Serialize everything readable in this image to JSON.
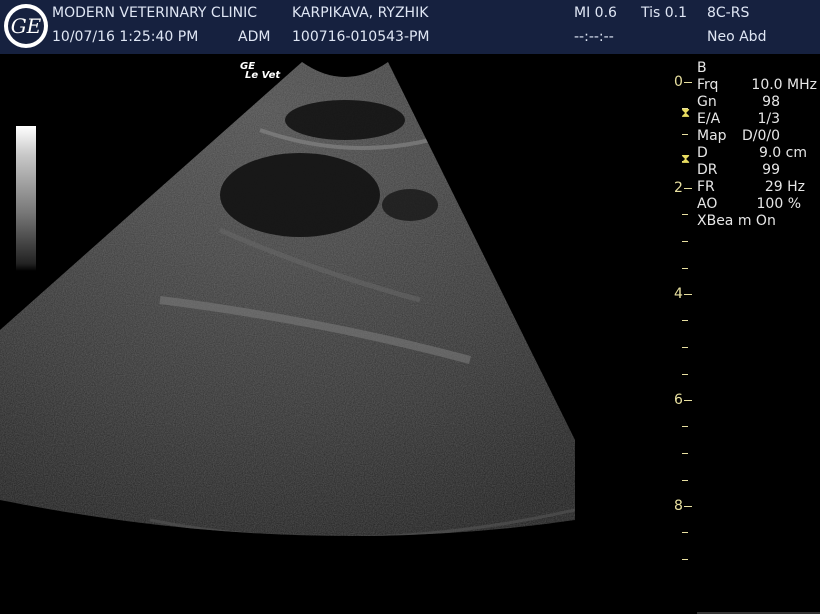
{
  "header": {
    "clinic_name": "MODERN VETERINARY CLINIC",
    "date_time": "10/07/16 1:25:40 PM",
    "operator": "ADM",
    "patient_name": "KARPIKAVA, RYZHIK",
    "exam_id": "100716-010543-PM",
    "mi": "MI 0.6",
    "tis": "Tis 0.1",
    "timer": "--:--:--",
    "probe": "8C-RS",
    "preset": "Neo Abd",
    "logo_text": "GE"
  },
  "image": {
    "vendor_mark_line1": "GE",
    "vendor_mark_line2": "Le Vet"
  },
  "params": {
    "mode": "B",
    "rows": [
      {
        "label": "Frq",
        "value": "10.0 MHz"
      },
      {
        "label": "Gn",
        "value": "98"
      },
      {
        "label": "E/A",
        "value": "1/3"
      },
      {
        "label": "Map",
        "value": "D/0/0"
      },
      {
        "label": "D",
        "value": "9.0 cm"
      },
      {
        "label": "DR",
        "value": "99"
      },
      {
        "label": "FR",
        "value": "29 Hz"
      },
      {
        "label": "AO",
        "value": "100 %"
      },
      {
        "label": "XBea m On",
        "value": ""
      }
    ]
  },
  "depth_scale": {
    "labels": [
      "0",
      "2",
      "4",
      "6",
      "8"
    ],
    "max_depth_cm": 9.0
  },
  "colors": {
    "header_bg": "#16213f",
    "header_text": "#dfe6f4",
    "scale": "#e8e0a0",
    "focus_marker": "#e8dc60"
  }
}
